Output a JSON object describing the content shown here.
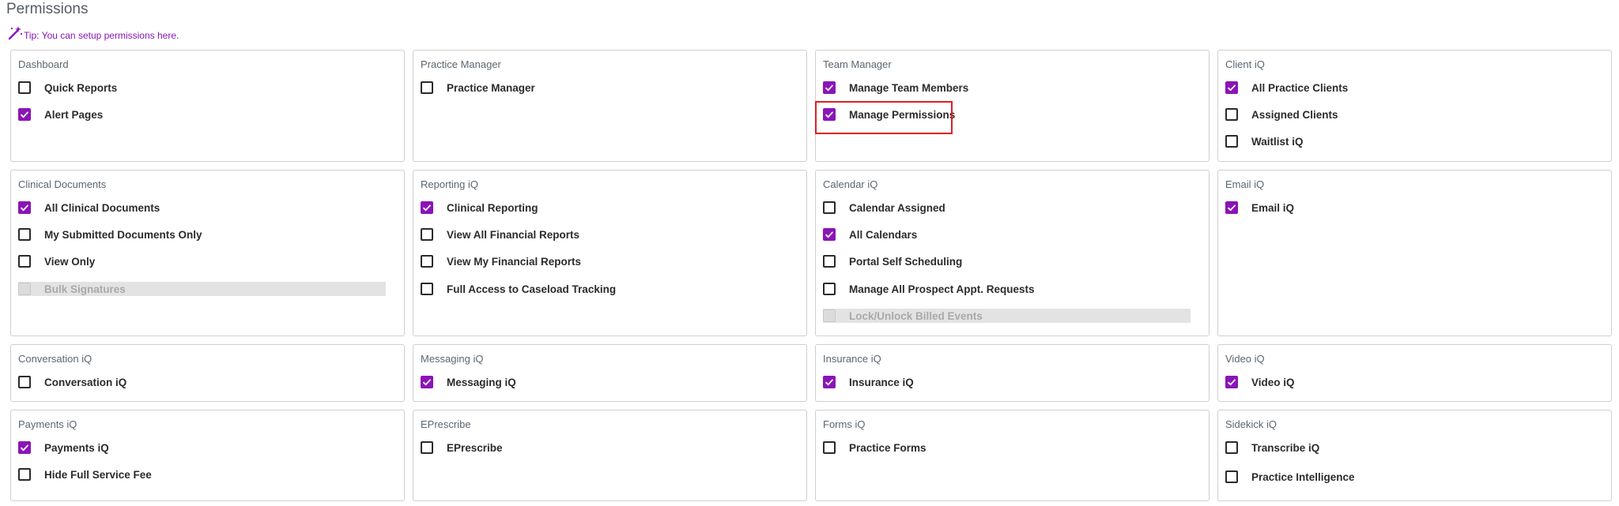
{
  "header": {
    "title": "Permissions",
    "tip": "Tip: You can setup permissions here."
  },
  "colors": {
    "accent": "#8a14b8",
    "highlight": "#e01f1f"
  },
  "cards": [
    {
      "title": "Dashboard",
      "items": [
        {
          "label": "Quick Reports",
          "checked": false
        },
        {
          "label": "Alert Pages",
          "checked": true
        }
      ]
    },
    {
      "title": "Practice Manager",
      "items": [
        {
          "label": "Practice Manager",
          "checked": false
        }
      ]
    },
    {
      "title": "Team Manager",
      "items": [
        {
          "label": "Manage Team Members",
          "checked": true
        },
        {
          "label": "Manage Permissions",
          "checked": true
        }
      ]
    },
    {
      "title": "Client iQ",
      "items": [
        {
          "label": "All Practice Clients",
          "checked": true
        },
        {
          "label": "Assigned Clients",
          "checked": false
        },
        {
          "label": "Waitlist iQ",
          "checked": false
        }
      ]
    },
    {
      "title": "Clinical Documents",
      "items": [
        {
          "label": "All Clinical Documents",
          "checked": true
        },
        {
          "label": "My Submitted Documents Only",
          "checked": false
        },
        {
          "label": "View Only",
          "checked": false
        },
        {
          "label": "Bulk Signatures",
          "checked": false,
          "disabled": true
        }
      ]
    },
    {
      "title": "Reporting iQ",
      "items": [
        {
          "label": "Clinical Reporting",
          "checked": true
        },
        {
          "label": "View All Financial Reports",
          "checked": false
        },
        {
          "label": "View My Financial Reports",
          "checked": false
        },
        {
          "label": "Full Access to Caseload Tracking",
          "checked": false
        }
      ]
    },
    {
      "title": "Calendar iQ",
      "items": [
        {
          "label": "Calendar Assigned",
          "checked": false
        },
        {
          "label": "All Calendars",
          "checked": true
        },
        {
          "label": "Portal Self Scheduling",
          "checked": false
        },
        {
          "label": "Manage All Prospect Appt. Requests",
          "checked": false
        },
        {
          "label": "Lock/Unlock Billed Events",
          "checked": false,
          "disabled": true
        }
      ]
    },
    {
      "title": "Email iQ",
      "items": [
        {
          "label": "Email iQ",
          "checked": true
        }
      ]
    },
    {
      "title": "Conversation iQ",
      "items": [
        {
          "label": "Conversation iQ",
          "checked": false
        }
      ]
    },
    {
      "title": "Messaging iQ",
      "items": [
        {
          "label": "Messaging iQ",
          "checked": true
        }
      ]
    },
    {
      "title": "Insurance iQ",
      "items": [
        {
          "label": "Insurance iQ",
          "checked": true
        }
      ]
    },
    {
      "title": "Video iQ",
      "items": [
        {
          "label": "Video iQ",
          "checked": true
        }
      ]
    },
    {
      "title": "Payments iQ",
      "items": [
        {
          "label": "Payments iQ",
          "checked": true
        },
        {
          "label": "Hide Full Service Fee",
          "checked": false
        }
      ]
    },
    {
      "title": "EPrescribe",
      "items": [
        {
          "label": "EPrescribe",
          "checked": false
        }
      ]
    },
    {
      "title": "Forms iQ",
      "items": [
        {
          "label": "Practice Forms",
          "checked": false
        }
      ]
    },
    {
      "title": "Sidekick iQ",
      "items": [
        {
          "label": "Transcribe iQ",
          "checked": false
        },
        {
          "label": "Practice Intelligence",
          "checked": false
        }
      ]
    }
  ]
}
